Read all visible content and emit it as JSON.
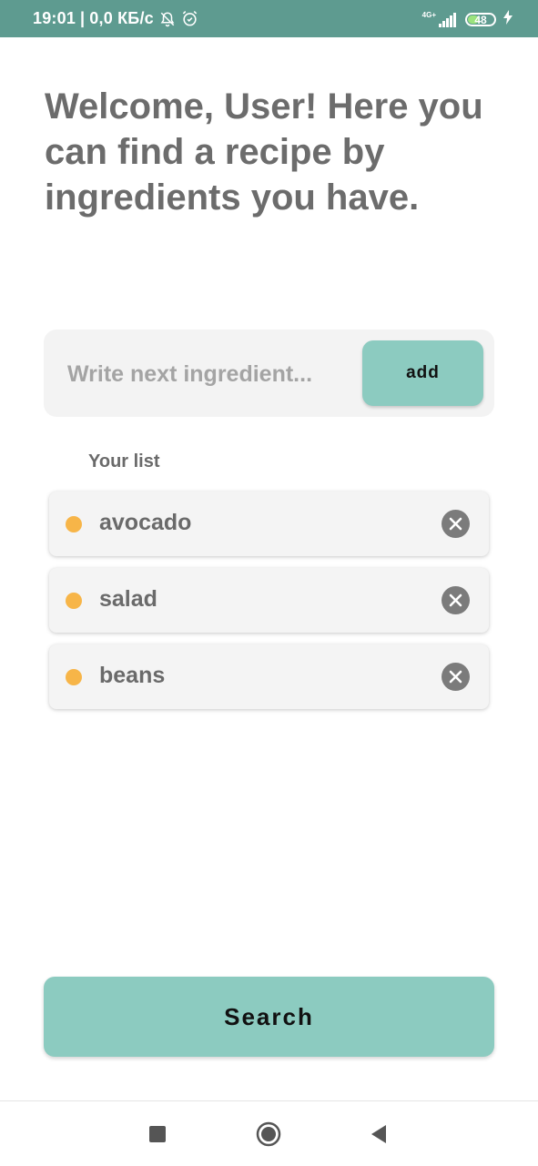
{
  "status_bar": {
    "time": "19:01",
    "separator": "|",
    "data_rate": "0,0 КБ/с",
    "network_type": "4G+",
    "battery_level": "48",
    "battery_fraction": 0.48,
    "background_color": "#5e9b90"
  },
  "header": {
    "title": "Welcome, User! Here you can find a recipe by ingredients you have."
  },
  "ingredient_entry": {
    "input_value": "",
    "placeholder": "Write next ingredient...",
    "add_label": "add"
  },
  "list": {
    "label": "Your list",
    "items": [
      {
        "name": "avocado",
        "dot_color": "#f7b548"
      },
      {
        "name": "salad",
        "dot_color": "#f7b548"
      },
      {
        "name": "beans",
        "dot_color": "#f7b548"
      }
    ]
  },
  "search_button": {
    "label": "Search"
  },
  "colors": {
    "accent": "#8ccbc0",
    "text": "#6c6c6c",
    "dot": "#f7b548",
    "remove_icon": "#7b7b7b"
  },
  "icons": {
    "status_left": [
      "bell-off-icon",
      "alarm-icon"
    ],
    "status_right": [
      "signal-icon",
      "battery-icon",
      "charging-icon"
    ],
    "list_item_action": "remove-icon",
    "nav": [
      "recents-square-icon",
      "home-circle-icon",
      "back-triangle-icon"
    ]
  }
}
